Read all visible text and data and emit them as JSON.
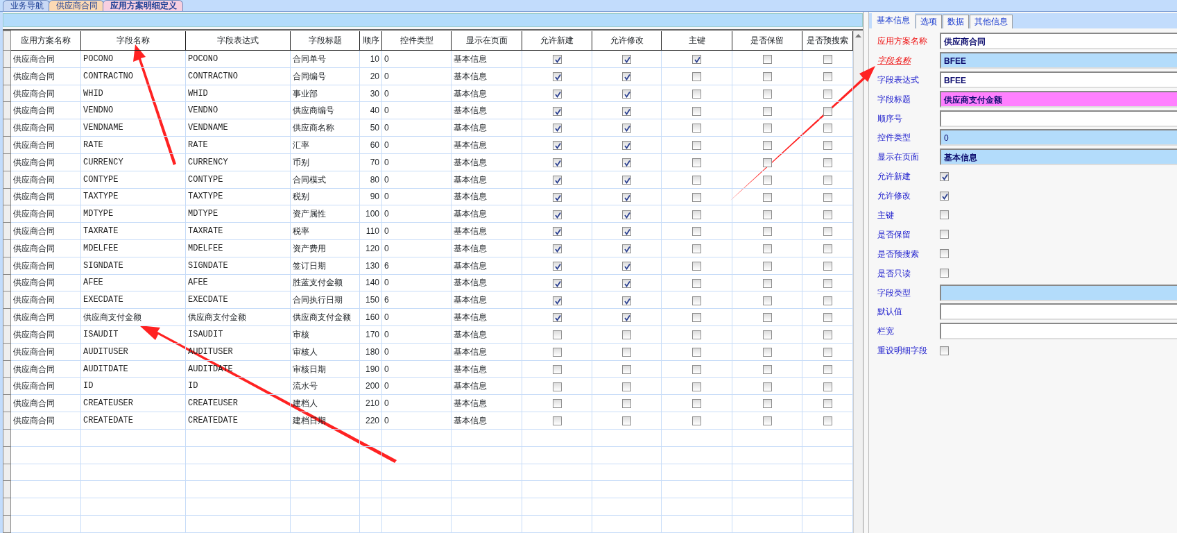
{
  "breadcrumb_tabs": [
    {
      "label": "业务导航",
      "selected": false,
      "color": "#c9d9f5"
    },
    {
      "label": "供应商合同",
      "selected": false,
      "color": "#fbd9b4"
    },
    {
      "label": "应用方案明细定义",
      "selected": true,
      "color": "#f7cfe0"
    }
  ],
  "grid": {
    "columns": [
      "应用方案名称",
      "字段名称",
      "字段表达式",
      "字段标题",
      "顺序",
      "控件类型",
      "显示在页面",
      "允许新建",
      "允许修改",
      "主键",
      "是否保留",
      "是否预搜索"
    ],
    "rows": [
      {
        "scheme": "供应商合同",
        "field_name": "POCONO",
        "field_expr": "POCONO",
        "field_title": "合同单号",
        "order": "10",
        "control_type": "0",
        "page": "基本信息",
        "allow_new": true,
        "allow_edit": true,
        "primary_key": true,
        "reserved": false,
        "presearch": false
      },
      {
        "scheme": "供应商合同",
        "field_name": "CONTRACTNO",
        "field_expr": "CONTRACTNO",
        "field_title": "合同编号",
        "order": "20",
        "control_type": "0",
        "page": "基本信息",
        "allow_new": true,
        "allow_edit": true,
        "primary_key": false,
        "reserved": false,
        "presearch": false
      },
      {
        "scheme": "供应商合同",
        "field_name": "WHID",
        "field_expr": "WHID",
        "field_title": "事业部",
        "order": "30",
        "control_type": "0",
        "page": "基本信息",
        "allow_new": true,
        "allow_edit": true,
        "primary_key": false,
        "reserved": false,
        "presearch": false
      },
      {
        "scheme": "供应商合同",
        "field_name": "VENDNO",
        "field_expr": "VENDNO",
        "field_title": "供应商编号",
        "order": "40",
        "control_type": "0",
        "page": "基本信息",
        "allow_new": true,
        "allow_edit": true,
        "primary_key": false,
        "reserved": false,
        "presearch": false
      },
      {
        "scheme": "供应商合同",
        "field_name": "VENDNAME",
        "field_expr": "VENDNAME",
        "field_title": "供应商名称",
        "order": "50",
        "control_type": "0",
        "page": "基本信息",
        "allow_new": true,
        "allow_edit": true,
        "primary_key": false,
        "reserved": false,
        "presearch": false
      },
      {
        "scheme": "供应商合同",
        "field_name": "RATE",
        "field_expr": "RATE",
        "field_title": "汇率",
        "order": "60",
        "control_type": "0",
        "page": "基本信息",
        "allow_new": true,
        "allow_edit": true,
        "primary_key": false,
        "reserved": false,
        "presearch": false
      },
      {
        "scheme": "供应商合同",
        "field_name": "CURRENCY",
        "field_expr": "CURRENCY",
        "field_title": "币别",
        "order": "70",
        "control_type": "0",
        "page": "基本信息",
        "allow_new": true,
        "allow_edit": true,
        "primary_key": false,
        "reserved": false,
        "presearch": false
      },
      {
        "scheme": "供应商合同",
        "field_name": "CONTYPE",
        "field_expr": "CONTYPE",
        "field_title": "合同模式",
        "order": "80",
        "control_type": "0",
        "page": "基本信息",
        "allow_new": true,
        "allow_edit": true,
        "primary_key": false,
        "reserved": false,
        "presearch": false
      },
      {
        "scheme": "供应商合同",
        "field_name": "TAXTYPE",
        "field_expr": "TAXTYPE",
        "field_title": "税别",
        "order": "90",
        "control_type": "0",
        "page": "基本信息",
        "allow_new": true,
        "allow_edit": true,
        "primary_key": false,
        "reserved": false,
        "presearch": false
      },
      {
        "scheme": "供应商合同",
        "field_name": "MDTYPE",
        "field_expr": "MDTYPE",
        "field_title": "资产属性",
        "order": "100",
        "control_type": "0",
        "page": "基本信息",
        "allow_new": true,
        "allow_edit": true,
        "primary_key": false,
        "reserved": false,
        "presearch": false
      },
      {
        "scheme": "供应商合同",
        "field_name": "TAXRATE",
        "field_expr": "TAXRATE",
        "field_title": "税率",
        "order": "110",
        "control_type": "0",
        "page": "基本信息",
        "allow_new": true,
        "allow_edit": true,
        "primary_key": false,
        "reserved": false,
        "presearch": false
      },
      {
        "scheme": "供应商合同",
        "field_name": "MDELFEE",
        "field_expr": "MDELFEE",
        "field_title": "资产费用",
        "order": "120",
        "control_type": "0",
        "page": "基本信息",
        "allow_new": true,
        "allow_edit": true,
        "primary_key": false,
        "reserved": false,
        "presearch": false
      },
      {
        "scheme": "供应商合同",
        "field_name": "SIGNDATE",
        "field_expr": "SIGNDATE",
        "field_title": "签订日期",
        "order": "130",
        "control_type": "6",
        "page": "基本信息",
        "allow_new": true,
        "allow_edit": true,
        "primary_key": false,
        "reserved": false,
        "presearch": false
      },
      {
        "scheme": "供应商合同",
        "field_name": "AFEE",
        "field_expr": "AFEE",
        "field_title": "胜蓝支付金额",
        "order": "140",
        "control_type": "0",
        "page": "基本信息",
        "allow_new": true,
        "allow_edit": true,
        "primary_key": false,
        "reserved": false,
        "presearch": false
      },
      {
        "scheme": "供应商合同",
        "field_name": "EXECDATE",
        "field_expr": "EXECDATE",
        "field_title": "合同执行日期",
        "order": "150",
        "control_type": "6",
        "page": "基本信息",
        "allow_new": true,
        "allow_edit": true,
        "primary_key": false,
        "reserved": false,
        "presearch": false
      },
      {
        "scheme": "供应商合同",
        "field_name": "供应商支付金额",
        "field_expr": "供应商支付金额",
        "field_title": "供应商支付金额",
        "order": "160",
        "control_type": "0",
        "page": "基本信息",
        "allow_new": true,
        "allow_edit": true,
        "primary_key": false,
        "reserved": false,
        "presearch": false
      },
      {
        "scheme": "供应商合同",
        "field_name": "ISAUDIT",
        "field_expr": "ISAUDIT",
        "field_title": "审核",
        "order": "170",
        "control_type": "0",
        "page": "基本信息",
        "allow_new": false,
        "allow_edit": false,
        "primary_key": false,
        "reserved": false,
        "presearch": false
      },
      {
        "scheme": "供应商合同",
        "field_name": "AUDITUSER",
        "field_expr": "AUDITUSER",
        "field_title": "审核人",
        "order": "180",
        "control_type": "0",
        "page": "基本信息",
        "allow_new": false,
        "allow_edit": false,
        "primary_key": false,
        "reserved": false,
        "presearch": false
      },
      {
        "scheme": "供应商合同",
        "field_name": "AUDITDATE",
        "field_expr": "AUDITDATE",
        "field_title": "审核日期",
        "order": "190",
        "control_type": "0",
        "page": "基本信息",
        "allow_new": false,
        "allow_edit": false,
        "primary_key": false,
        "reserved": false,
        "presearch": false
      },
      {
        "scheme": "供应商合同",
        "field_name": "ID",
        "field_expr": "ID",
        "field_title": "流水号",
        "order": "200",
        "control_type": "0",
        "page": "基本信息",
        "allow_new": false,
        "allow_edit": false,
        "primary_key": false,
        "reserved": false,
        "presearch": false
      },
      {
        "scheme": "供应商合同",
        "field_name": "CREATEUSER",
        "field_expr": "CREATEUSER",
        "field_title": "建档人",
        "order": "210",
        "control_type": "0",
        "page": "基本信息",
        "allow_new": false,
        "allow_edit": false,
        "primary_key": false,
        "reserved": false,
        "presearch": false
      },
      {
        "scheme": "供应商合同",
        "field_name": "CREATEDATE",
        "field_expr": "CREATEDATE",
        "field_title": "建档日期",
        "order": "220",
        "control_type": "0",
        "page": "基本信息",
        "allow_new": false,
        "allow_edit": false,
        "primary_key": false,
        "reserved": false,
        "presearch": false
      }
    ]
  },
  "detail_panel": {
    "tabs": [
      {
        "label": "基本信息",
        "selected": true
      },
      {
        "label": "选项",
        "selected": false
      },
      {
        "label": "数据",
        "selected": false
      },
      {
        "label": "其他信息",
        "selected": false
      }
    ],
    "fields": [
      {
        "label": "应用方案名称",
        "required": true,
        "link": false,
        "kind": "text",
        "value": "供应商合同",
        "bold": true,
        "color": "#ffffff"
      },
      {
        "label": "字段名称",
        "required": true,
        "link": true,
        "kind": "text",
        "value": "BFEE",
        "bold": true,
        "color": "#b3dcfb"
      },
      {
        "label": "字段表达式",
        "required": false,
        "link": false,
        "kind": "text",
        "value": "BFEE",
        "bold": true,
        "color": "#ffffff"
      },
      {
        "label": "字段标题",
        "required": false,
        "link": false,
        "kind": "text",
        "value": "供应商支付金额",
        "bold": true,
        "color": "#ff80ff"
      },
      {
        "label": "顺序号",
        "required": false,
        "link": false,
        "kind": "text",
        "color": "#ffffff"
      },
      {
        "label": "控件类型",
        "required": false,
        "link": false,
        "kind": "text",
        "value": "0",
        "bold": false,
        "color": "#b3dcfb"
      },
      {
        "label": "显示在页面",
        "required": false,
        "link": false,
        "kind": "text",
        "value": "基本信息",
        "bold": true,
        "color": "#b3dcfb"
      },
      {
        "label": "允许新建",
        "required": false,
        "link": false,
        "kind": "checkbox",
        "checked": true
      },
      {
        "label": "允许修改",
        "required": false,
        "link": false,
        "kind": "checkbox",
        "checked": true
      },
      {
        "label": "主键",
        "required": false,
        "link": false,
        "kind": "checkbox",
        "checked": false
      },
      {
        "label": "是否保留",
        "required": false,
        "link": false,
        "kind": "checkbox",
        "checked": false
      },
      {
        "label": "是否预搜索",
        "required": false,
        "link": false,
        "kind": "checkbox",
        "checked": false
      },
      {
        "label": "是否只读",
        "required": false,
        "link": false,
        "kind": "checkbox",
        "checked": false
      },
      {
        "label": "字段类型",
        "required": false,
        "link": false,
        "kind": "text",
        "color": "#b3dcfb"
      },
      {
        "label": "默认值",
        "required": false,
        "link": false,
        "kind": "text",
        "color": "#ffffff"
      },
      {
        "label": "栏宽",
        "required": false,
        "link": false,
        "kind": "text",
        "color": "#ffffff"
      },
      {
        "label": "重设明细字段",
        "required": false,
        "link": false,
        "kind": "checkbox",
        "checked": false
      }
    ]
  }
}
